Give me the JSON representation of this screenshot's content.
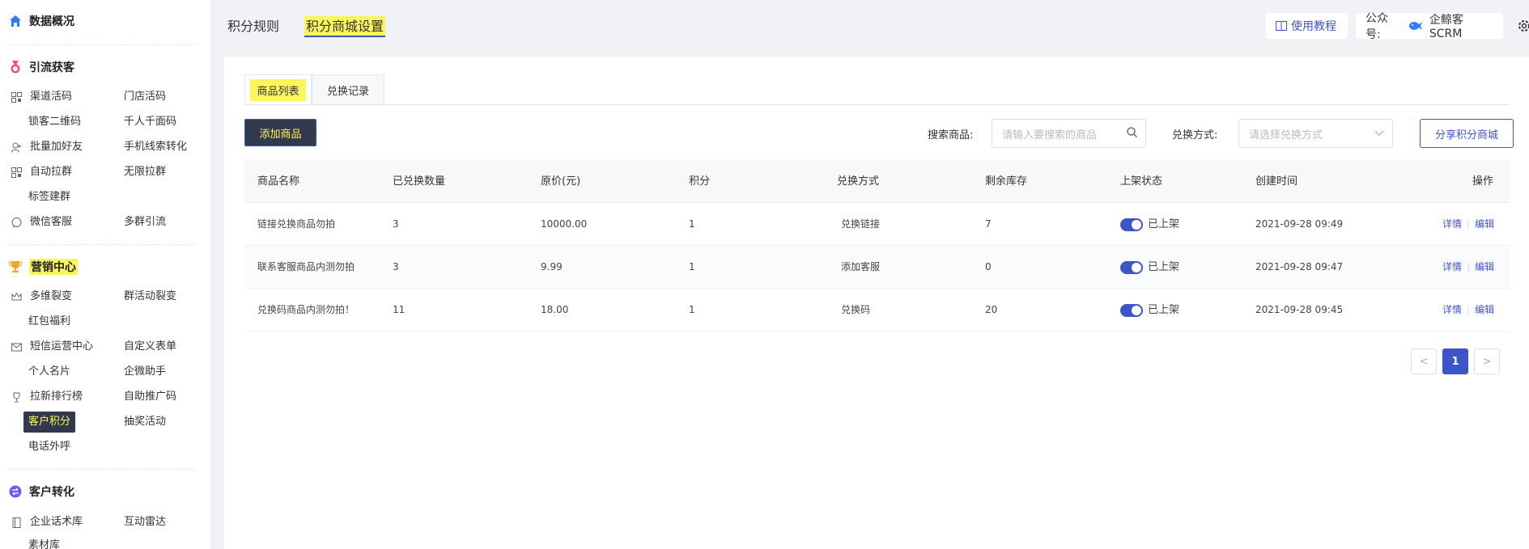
{
  "sidebar": {
    "sections": [
      {
        "title": "数据概况",
        "icon": "home-icon",
        "color": "#2f7df6"
      },
      {
        "title": "引流获客",
        "icon": "medal-icon",
        "color": "#f0506e"
      },
      {
        "title": "营销中心",
        "icon": "trophy-icon",
        "color": "#f5a623"
      },
      {
        "title": "客户转化",
        "icon": "exchange-icon",
        "color": "#6a5df0"
      }
    ],
    "acquire": [
      "渠道活码",
      "门店活码",
      "锁客二维码",
      "千人千面码",
      "批量加好友",
      "手机线索转化",
      "自动拉群",
      "无限拉群",
      "标签建群",
      "微信客服",
      "多群引流"
    ],
    "marketing": [
      "多维裂变",
      "群活动裂变",
      "红包福利",
      "短信运营中心",
      "自定义表单",
      "个人名片",
      "企微助手",
      "拉新排行榜",
      "自助推广码",
      "客户积分",
      "抽奖活动",
      "电话外呼"
    ],
    "convert": [
      "企业话术库",
      "互动雷达",
      "素材库"
    ]
  },
  "topbar": {
    "tabs": [
      "积分规则",
      "积分商城设置"
    ],
    "tutorial": "使用教程",
    "account_label": "公众号:",
    "account_name": "企鲸客SCRM"
  },
  "main": {
    "subtabs": [
      "商品列表",
      "兑换记录"
    ],
    "add_button": "添加商品",
    "search_label": "搜索商品:",
    "search_placeholder": "请输入要搜索的商品",
    "method_label": "兑换方式:",
    "method_placeholder": "请选择兑换方式",
    "share_button": "分享积分商城",
    "columns": [
      "商品名称",
      "已兑换数量",
      "原价(元)",
      "积分",
      "兑换方式",
      "剩余库存",
      "上架状态",
      "创建时间",
      "操作"
    ],
    "rows": [
      {
        "name": "链接兑换商品勿拍",
        "redeemed": "3",
        "price": "10000.00",
        "points": "1",
        "method": "兑换链接",
        "stock": "7",
        "status": "已上架",
        "created": "2021-09-28 09:49",
        "detail": "详情",
        "edit": "编辑"
      },
      {
        "name": "联系客服商品内测勿拍",
        "redeemed": "3",
        "price": "9.99",
        "points": "1",
        "method": "添加客服",
        "stock": "0",
        "status": "已上架",
        "created": "2021-09-28 09:47",
        "detail": "详情",
        "edit": "编辑"
      },
      {
        "name": "兑换码商品内测勿拍！",
        "redeemed": "11",
        "price": "18.00",
        "points": "1",
        "method": "兑换码",
        "stock": "20",
        "status": "已上架",
        "created": "2021-09-28 09:45",
        "detail": "详情",
        "edit": "编辑"
      }
    ],
    "pagination": {
      "prev": "<",
      "current": "1",
      "next": ">"
    }
  },
  "colors": {
    "accent": "#3e55c9",
    "highlight": "#fbf75a",
    "dark": "#33394d"
  }
}
